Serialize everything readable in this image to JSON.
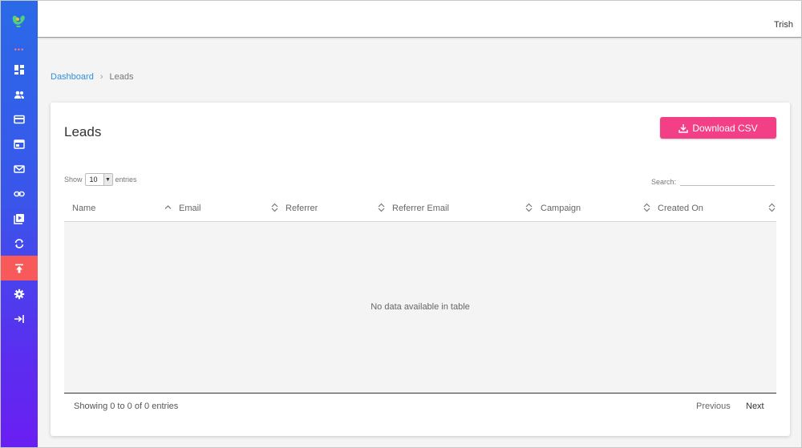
{
  "topbar": {
    "user_name": "Trish"
  },
  "breadcrumb": {
    "home": "Dashboard",
    "separator": "›",
    "current": "Leads"
  },
  "page": {
    "title": "Leads",
    "download_label": "Download CSV"
  },
  "table_controls": {
    "show_label": "Show",
    "page_length": "10",
    "entries_label": "entries",
    "search_label": "Search:"
  },
  "table": {
    "columns": [
      "Name",
      "Email",
      "Referrer",
      "Referrer Email",
      "Campaign",
      "Created On"
    ],
    "empty_message": "No data available in table"
  },
  "footer": {
    "info": "Showing 0 to 0 of 0 entries",
    "previous": "Previous",
    "next": "Next"
  },
  "sidebar": {
    "items": [
      "dashboard-icon",
      "users-icon",
      "card-icon",
      "browser-icon",
      "mail-icon",
      "link-icon",
      "media-icon",
      "sync-icon",
      "upload-icon",
      "gear-icon",
      "logout-icon"
    ],
    "active_index": 8
  },
  "colors": {
    "sidebar_top": "#2a6ae8",
    "sidebar_bottom": "#6a1ff2",
    "active_item": "#f85a5a",
    "primary_button": "#f33f86",
    "link": "#2f8fe0"
  }
}
